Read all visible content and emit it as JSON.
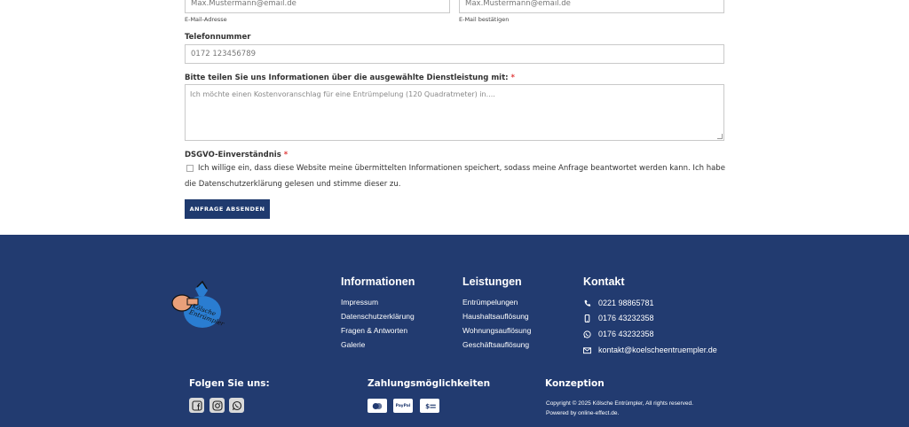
{
  "form": {
    "email_value": "Max.Mustermann@email.de",
    "email_sublabel": "E-Mail-Adresse",
    "email_confirm_value": "Max.Mustermann@email.de",
    "email_confirm_sublabel": "E-Mail bestätigen",
    "phone_label": "Telefonnummer",
    "phone_placeholder": "0172 123456789",
    "message_label": "Bitte teilen Sie uns Informationen über die ausgewählte Dienstleistung mit:",
    "required_mark": "*",
    "message_placeholder": "Ich möchte einen Kostenvoranschlag für eine Entrümpelung (120 Quadratmeter) in....",
    "gdpr_label": "DSGVO-Einverständnis",
    "gdpr_text": "Ich willige ein, dass diese Website meine übermittelten Informationen speichert, sodass meine Anfrage beantwortet werden kann. Ich habe die Datenschutzerklärung gelesen und stimme dieser zu.",
    "submit_label": "ANFRAGE ABSENDEN"
  },
  "footer": {
    "logo_text": "Kölsche Entrümpler",
    "info": {
      "heading": "Informationen",
      "links": [
        "Impressum",
        "Datenschutzerklärung",
        "Fragen & Antworten",
        "Galerie"
      ]
    },
    "services": {
      "heading": "Leistungen",
      "links": [
        "Entrümpelungen",
        "Haushaltsauflösung",
        "Wohnungsauflösung",
        "Geschäftsauflösung"
      ]
    },
    "contact": {
      "heading": "Kontakt",
      "phone": "0221 98865781",
      "mobile": "0176 43232358",
      "whatsapp": "0176 43232358",
      "email": "kontakt@koelscheentruempler.de"
    },
    "follow_heading": "Folgen Sie uns:",
    "payment_heading": "Zahlungsmöglichkeiten",
    "payment_methods": [
      "Mastercard",
      "PayPal",
      "Cash"
    ],
    "paypal_label": "PayPal",
    "concept_heading": "Konzeption",
    "copyright_text": "Copyright © 2025 Kölsche Entrümpler, All rights reserved. Powered by",
    "powered_by": "online-effect.de",
    "copyright_end": ".",
    "colors": {
      "footer_bg": "#223b70",
      "button_bg": "#1f3a6e",
      "required": "#e03a3a"
    }
  }
}
